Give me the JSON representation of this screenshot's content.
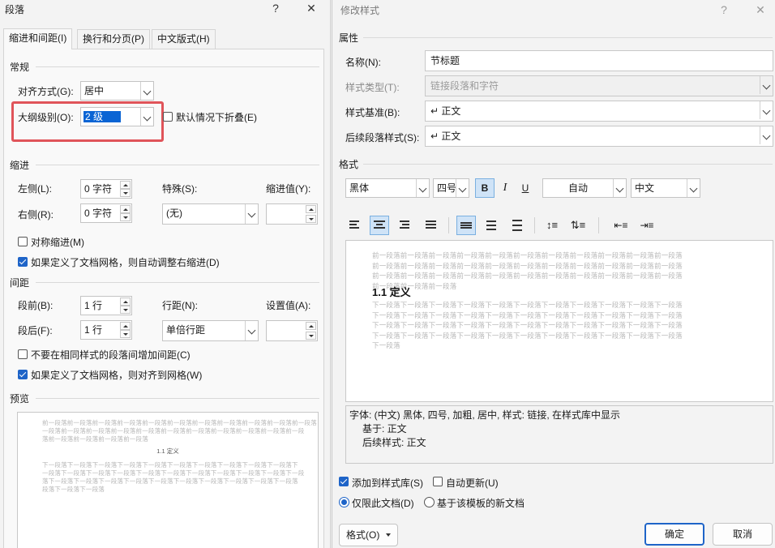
{
  "left_dialog": {
    "title": "段落",
    "help_icon": "help-icon",
    "close_icon": "close-icon",
    "tabs": [
      {
        "label": "缩进和间距(I)",
        "active": true
      },
      {
        "label": "换行和分页(P)",
        "active": false
      },
      {
        "label": "中文版式(H)",
        "active": false
      }
    ],
    "general": {
      "title": "常规",
      "alignment_label": "对齐方式(G):",
      "alignment_value": "居中",
      "outline_label": "大纲级别(O):",
      "outline_value": "2 级",
      "collapse_label": "默认情况下折叠(E)",
      "collapse_checked": false
    },
    "indent": {
      "title": "缩进",
      "left_label": "左侧(L):",
      "left_value": "0 字符",
      "right_label": "右侧(R):",
      "right_value": "0 字符",
      "special_label": "特殊(S):",
      "special_value": "(无)",
      "by_label": "缩进值(Y):",
      "by_value": "",
      "mirror_label": "对称缩进(M)",
      "mirror_checked": false,
      "grid_label": "如果定义了文档网格，则自动调整右缩进(D)",
      "grid_checked": true
    },
    "spacing": {
      "title": "间距",
      "before_label": "段前(B):",
      "before_value": "1 行",
      "after_label": "段后(F):",
      "after_value": "1 行",
      "line_label": "行距(N):",
      "line_value": "单倍行距",
      "at_label": "设置值(A):",
      "at_value": "",
      "no_space_label": "不要在相同样式的段落间增加间距(C)",
      "no_space_checked": false,
      "snap_label": "如果定义了文档网格，则对齐到网格(W)",
      "snap_checked": true
    },
    "preview": {
      "title": "预览",
      "prev_lines": [
        "前一段落前一段落前一段落前一段落前一段落前一段落前一段落前一段落前一段落前一段落前一段落",
        "一段落前一段落前一段落前一段落前一段落前一段落前一段落前一段落前一段落前一段落前一段",
        "落前一段落前一段落前一段落前一段落"
      ],
      "heading": "1.1  定义",
      "next_lines": [
        "下一段落下一段落下一段落下一段落下一段落下一段落下一段落下一段落下一段落下一段落下",
        "一段落下一段落下一段落下一段落下一段落下一段落下一段落下一段落下一段落下一段落下一段",
        "落下一段落下一段落下一段落下一段落下一段落下一段落下一段落下一段落下一段落下一段落",
        "段落下一段落下一段落"
      ]
    }
  },
  "right_dialog": {
    "title": "修改样式",
    "help_icon": "help-icon",
    "close_icon": "close-icon",
    "properties": {
      "title": "属性",
      "name_label": "名称(N):",
      "name_value": "节标题",
      "type_label": "样式类型(T):",
      "type_value": "链接段落和字符",
      "based_label": "样式基准(B):",
      "based_value": "↵ 正文",
      "next_label": "后续段落样式(S):",
      "next_value": "↵ 正文"
    },
    "format": {
      "title": "格式",
      "font": "黑体",
      "size": "四号",
      "bold": "B",
      "italic": "I",
      "underline": "U",
      "color": "自动",
      "script": "中文"
    },
    "preview": {
      "prev_lines": [
        "前一段落前一段落前一段落前一段落前一段落前一段落前一段落前一段落前一段落前一段落前一段落",
        "前一段落前一段落前一段落前一段落前一段落前一段落前一段落前一段落前一段落前一段落前一段落",
        "前一段落前一段落前一段落前一段落前一段落前一段落前一段落前一段落前一段落前一段落前一段落",
        "前一段落前一段落前一段落"
      ],
      "heading": "1.1  定义",
      "next_lines": [
        "下一段落下一段落下一段落下一段落下一段落下一段落下一段落下一段落下一段落下一段落下一段落",
        "下一段落下一段落下一段落下一段落下一段落下一段落下一段落下一段落下一段落下一段落下一段落",
        "下一段落下一段落下一段落下一段落下一段落下一段落下一段落下一段落下一段落下一段落下一段落",
        "下一段落下一段落下一段落下一段落下一段落下一段落下一段落下一段落下一段落下一段落下一段落",
        "下一段落"
      ]
    },
    "description": {
      "line1": "字体: (中文) 黑体, 四号, 加粗, 居中, 样式: 链接, 在样式库中显示",
      "line2": "基于: 正文",
      "line3": "后续样式: 正文"
    },
    "add_to_gallery_label": "添加到样式库(S)",
    "add_to_gallery_checked": true,
    "auto_update_label": "自动更新(U)",
    "auto_update_checked": false,
    "only_doc_label": "仅限此文档(D)",
    "new_docs_label": "基于该模板的新文档",
    "format_button": "格式(O)",
    "ok_button": "确定",
    "cancel_button": "取消"
  }
}
